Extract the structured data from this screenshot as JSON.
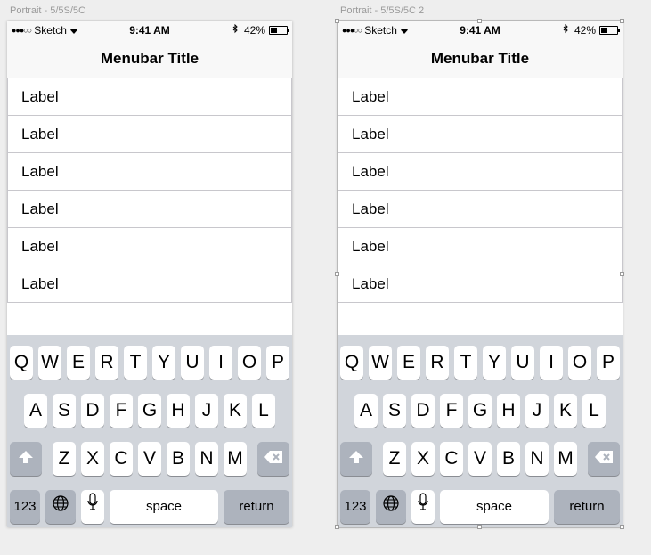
{
  "artboards": [
    {
      "label": "Portrait - 5/5S/5C"
    },
    {
      "label": "Portrait - 5/5S/5C 2"
    }
  ],
  "status": {
    "carrier": "Sketch",
    "time": "9:41 AM",
    "battery": "42%",
    "battery_level": 0.42
  },
  "navbar": {
    "title": "Menubar Title"
  },
  "rows": [
    "Label",
    "Label",
    "Label",
    "Label",
    "Label",
    "Label"
  ],
  "keyboard": {
    "row1": [
      "Q",
      "W",
      "E",
      "R",
      "T",
      "Y",
      "U",
      "I",
      "O",
      "P"
    ],
    "row2": [
      "A",
      "S",
      "D",
      "F",
      "G",
      "H",
      "J",
      "K",
      "L"
    ],
    "row3": [
      "Z",
      "X",
      "C",
      "V",
      "B",
      "N",
      "M"
    ],
    "numbers_label": "123",
    "space_label": "space",
    "return_label": "return"
  },
  "icons": {
    "shift": "shift-icon",
    "delete": "delete-icon",
    "globe": "globe-icon",
    "mic": "microphone-icon"
  }
}
